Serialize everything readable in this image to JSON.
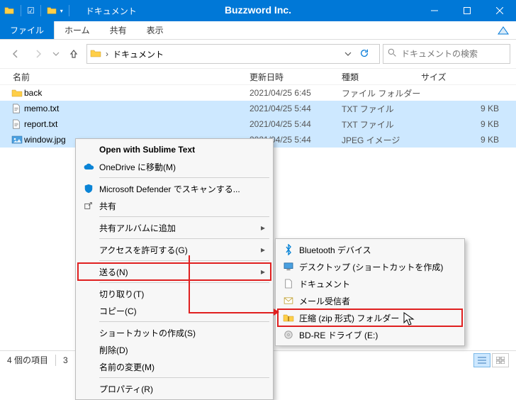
{
  "titlebar": {
    "title": "ドキュメント",
    "brand": "Buzzword Inc."
  },
  "ribbon": {
    "file": "ファイル",
    "home": "ホーム",
    "share": "共有",
    "view": "表示"
  },
  "address": {
    "folder": "ドキュメント"
  },
  "search": {
    "placeholder": "ドキュメントの検索"
  },
  "columns": {
    "name": "名前",
    "date": "更新日時",
    "type": "種類",
    "size": "サイズ"
  },
  "files": [
    {
      "name": "back",
      "date": "2021/04/25 6:45",
      "type": "ファイル フォルダー",
      "size": ""
    },
    {
      "name": "memo.txt",
      "date": "2021/04/25 5:44",
      "type": "TXT ファイル",
      "size": "9 KB"
    },
    {
      "name": "report.txt",
      "date": "2021/04/25 5:44",
      "type": "TXT ファイル",
      "size": "9 KB"
    },
    {
      "name": "window.jpg",
      "date": "2021/04/25 5:44",
      "type": "JPEG イメージ",
      "size": "9 KB"
    }
  ],
  "status": {
    "count": "4 個の項目",
    "selected_prefix": "3"
  },
  "ctx1": {
    "open_sublime": "Open with Sublime Text",
    "onedrive": "OneDrive に移動(M)",
    "defender": "Microsoft Defender でスキャンする...",
    "share": "共有",
    "album": "共有アルバムに追加",
    "access": "アクセスを許可する(G)",
    "send": "送る(N)",
    "cut": "切り取り(T)",
    "copy": "コピー(C)",
    "shortcut": "ショートカットの作成(S)",
    "delete": "削除(D)",
    "rename": "名前の変更(M)",
    "properties": "プロパティ(R)"
  },
  "ctx2": {
    "bluetooth": "Bluetooth デバイス",
    "desktop": "デスクトップ (ショートカットを作成)",
    "documents": "ドキュメント",
    "mail": "メール受信者",
    "zip": "圧縮 (zip 形式) フォルダー",
    "bdre": "BD-RE ドライブ (E:)"
  }
}
